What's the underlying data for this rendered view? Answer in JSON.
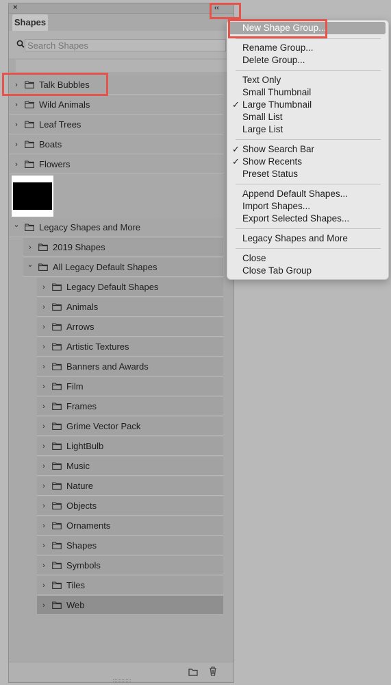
{
  "panel": {
    "close_glyph": "×",
    "collapse_glyph": "‹‹",
    "tab_label": "Shapes",
    "search_placeholder": "Search Shapes"
  },
  "groups": [
    {
      "label": "Talk Bubbles",
      "expanded": false
    },
    {
      "label": "Wild Animals",
      "expanded": false
    },
    {
      "label": "Leaf Trees",
      "expanded": false
    },
    {
      "label": "Boats",
      "expanded": false
    },
    {
      "label": "Flowers",
      "expanded": false
    },
    {
      "label": "Legacy Shapes and More",
      "expanded": true
    }
  ],
  "subgroups": [
    {
      "label": "2019 Shapes",
      "expanded": false
    },
    {
      "label": "All Legacy Default Shapes",
      "expanded": true
    }
  ],
  "legacy_items": [
    "Legacy Default Shapes",
    "Animals",
    "Arrows",
    "Artistic Textures",
    "Banners and Awards",
    "Film",
    "Frames",
    "Grime Vector Pack",
    "LightBulb",
    "Music",
    "Nature",
    "Objects",
    "Ornaments",
    "Shapes",
    "Symbols",
    "Tiles",
    "Web"
  ],
  "selected_item": "Web",
  "menu": {
    "items": [
      {
        "label": "New Shape Group...",
        "highlighted": true
      },
      {
        "label": "Rename Group..."
      },
      {
        "label": "Delete Group..."
      },
      {
        "label": "Text Only"
      },
      {
        "label": "Small Thumbnail"
      },
      {
        "label": "Large Thumbnail",
        "checked": true
      },
      {
        "label": "Small List"
      },
      {
        "label": "Large List"
      },
      {
        "label": "Show Search Bar",
        "checked": true
      },
      {
        "label": "Show Recents",
        "checked": true
      },
      {
        "label": "Preset Status"
      },
      {
        "label": "Append Default Shapes..."
      },
      {
        "label": "Import Shapes..."
      },
      {
        "label": "Export Selected Shapes..."
      },
      {
        "label": "Legacy Shapes and More"
      },
      {
        "label": "Close"
      },
      {
        "label": "Close Tab Group"
      }
    ],
    "check_glyph": "✓"
  },
  "colors": {
    "panel_bg": "#a9a9a9",
    "menu_bg": "#e8e8e8",
    "highlight": "#a7a7a7",
    "annotation_red": "#e5534b"
  }
}
